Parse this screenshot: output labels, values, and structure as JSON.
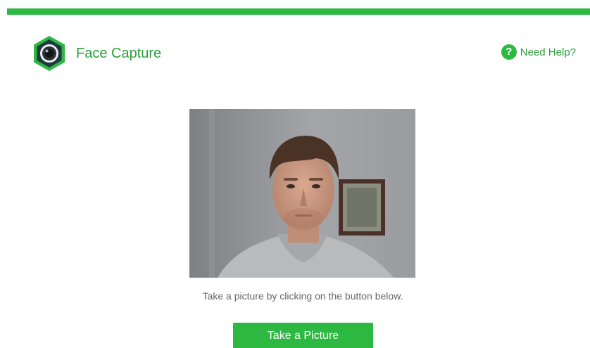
{
  "header": {
    "brand_name": "Face Capture",
    "logo_icon": "camera-lens-hexagon-icon",
    "help_label": "Need Help?",
    "help_icon": "question-circle-icon"
  },
  "camera": {
    "feed_description": "live camera preview"
  },
  "instruction": "Take a picture by clicking on the button below.",
  "actions": {
    "take_picture_label": "Take a Picture"
  },
  "colors": {
    "accent": "#2db842",
    "brand_text": "#2a9f3b",
    "logo_dark": "#1f3a3d"
  }
}
